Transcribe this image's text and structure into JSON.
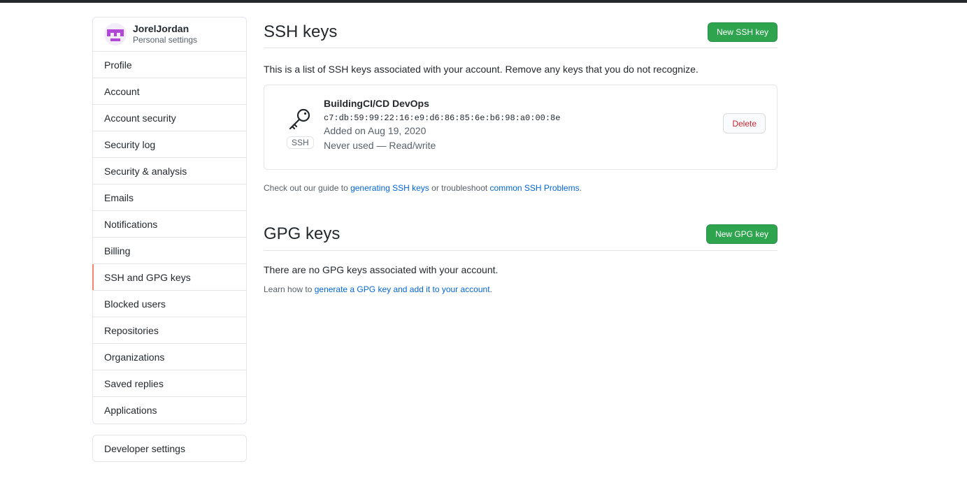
{
  "user": {
    "name": "JorelJordan",
    "subtitle": "Personal settings"
  },
  "sidebar": {
    "items": [
      {
        "label": "Profile"
      },
      {
        "label": "Account"
      },
      {
        "label": "Account security"
      },
      {
        "label": "Security log"
      },
      {
        "label": "Security & analysis"
      },
      {
        "label": "Emails"
      },
      {
        "label": "Notifications"
      },
      {
        "label": "Billing"
      },
      {
        "label": "SSH and GPG keys",
        "selected": true
      },
      {
        "label": "Blocked users"
      },
      {
        "label": "Repositories"
      },
      {
        "label": "Organizations"
      },
      {
        "label": "Saved replies"
      },
      {
        "label": "Applications"
      }
    ],
    "developer_settings": "Developer settings"
  },
  "ssh": {
    "heading": "SSH keys",
    "new_button": "New SSH key",
    "intro": "This is a list of SSH keys associated with your account. Remove any keys that you do not recognize.",
    "keys": [
      {
        "icon": "key-icon",
        "type_label": "SSH",
        "title": "BuildingCI/CD DevOps",
        "fingerprint": "c7:db:59:99:22:16:e9:d6:86:85:6e:b6:98:a0:00:8e",
        "added": "Added on Aug 19, 2020",
        "usage": "Never used — Read/write",
        "delete_label": "Delete"
      }
    ],
    "guide": {
      "prefix": "Check out our guide to ",
      "link1": "generating SSH keys",
      "middle": " or troubleshoot ",
      "link2": "common SSH Problems",
      "suffix": "."
    }
  },
  "gpg": {
    "heading": "GPG keys",
    "new_button": "New GPG key",
    "empty": "There are no GPG keys associated with your account.",
    "learn": {
      "prefix": "Learn how to ",
      "link": "generate a GPG key and add it to your account",
      "suffix": "."
    }
  },
  "colors": {
    "primary_button": "#2ea44f",
    "link": "#0366d6",
    "danger": "#cb2431",
    "selected_indicator": "#f9826c",
    "avatar": "#b047d6"
  }
}
